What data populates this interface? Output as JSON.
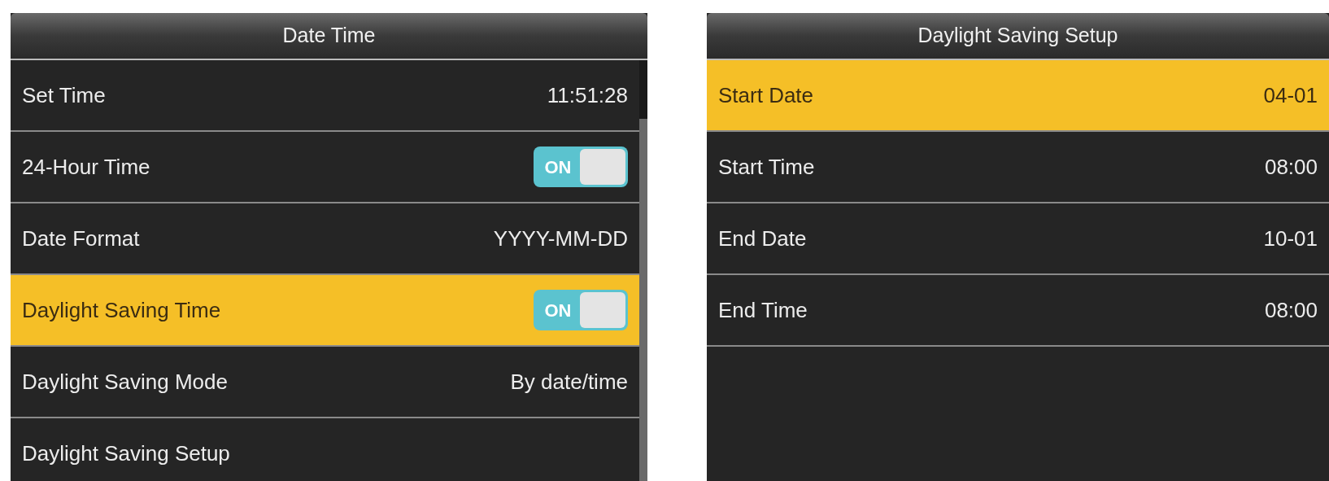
{
  "panels": [
    {
      "title": "Date Time",
      "scrollbar": true,
      "items": [
        {
          "label": "Set Time",
          "kind": "value",
          "value": "11:51:28",
          "selected": false
        },
        {
          "label": "24-Hour Time",
          "kind": "toggle",
          "toggle_text": "ON",
          "on": true,
          "selected": false
        },
        {
          "label": "Date Format",
          "kind": "value",
          "value": "YYYY-MM-DD",
          "selected": false
        },
        {
          "label": "Daylight Saving Time",
          "kind": "toggle",
          "toggle_text": "ON",
          "on": true,
          "selected": true
        },
        {
          "label": "Daylight Saving Mode",
          "kind": "value",
          "value": "By date/time",
          "selected": false
        },
        {
          "label": "Daylight Saving Setup",
          "kind": "plain",
          "selected": false
        }
      ]
    },
    {
      "title": "Daylight Saving Setup",
      "scrollbar": false,
      "items": [
        {
          "label": "Start Date",
          "kind": "value",
          "value": "04-01",
          "selected": true
        },
        {
          "label": "Start Time",
          "kind": "value",
          "value": "08:00",
          "selected": false
        },
        {
          "label": "End Date",
          "kind": "value",
          "value": "10-01",
          "selected": false
        },
        {
          "label": "End Time",
          "kind": "value",
          "value": "08:00",
          "selected": false
        }
      ]
    }
  ]
}
